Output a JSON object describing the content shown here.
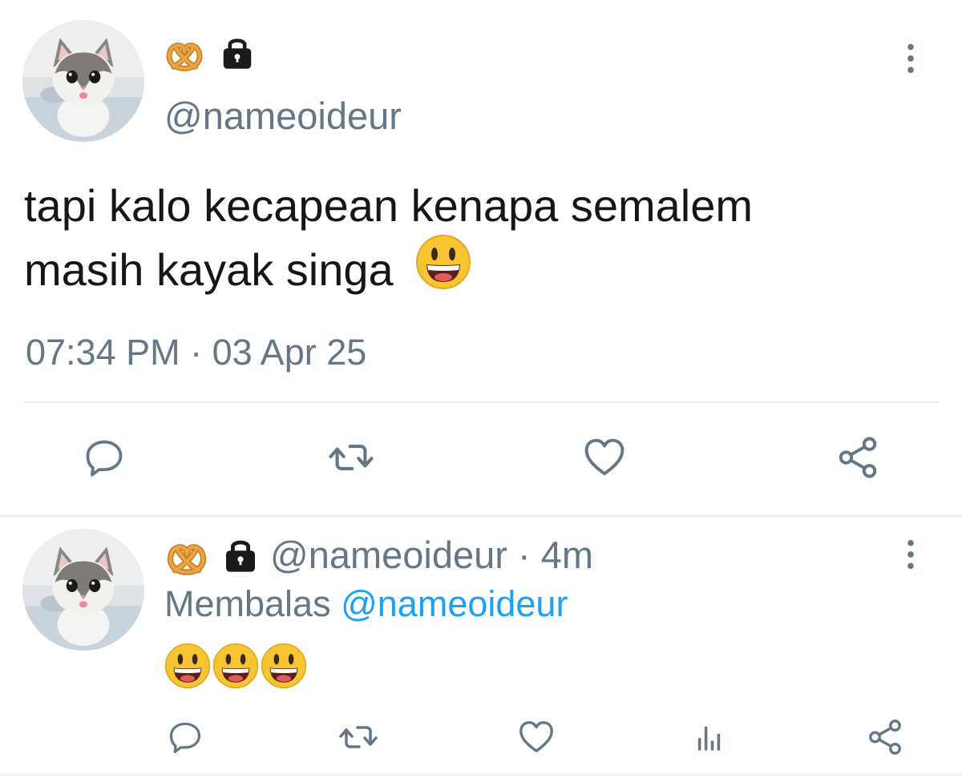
{
  "tweet": {
    "handle": "@nameoideur",
    "badges": [
      "pretzel-emoji",
      "lock-icon"
    ],
    "text_line1": "tapi kalo kecapean kenapa semalem",
    "text_line2": "masih kayak singa",
    "timestamp": "07:34 PM · 03 Apr 25",
    "actions": [
      "reply-icon",
      "retweet-icon",
      "like-icon",
      "share-icon"
    ]
  },
  "reply": {
    "handle": "@nameoideur",
    "separator": " · ",
    "time": "4m",
    "replying_label": "Membalas",
    "replying_to": "@nameoideur",
    "emoji_count": 3,
    "actions": [
      "reply-icon",
      "retweet-icon",
      "like-icon",
      "analytics-icon",
      "share-icon"
    ]
  },
  "colors": {
    "text": "#14171a",
    "secondary": "#657786",
    "link": "#1da1f2",
    "divider": "#e6ecf0"
  }
}
